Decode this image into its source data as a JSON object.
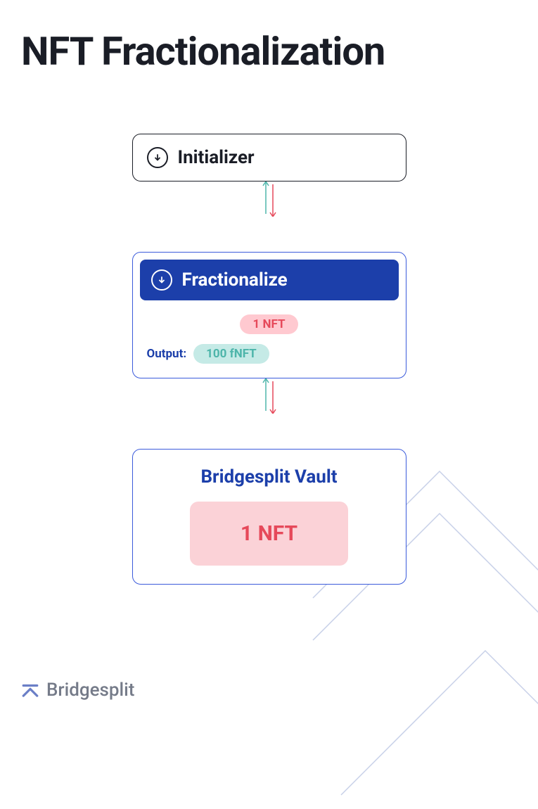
{
  "title": "NFT Fractionalization",
  "initializer": {
    "label": "Initializer"
  },
  "fractionalize": {
    "label": "Fractionalize",
    "input_pill": "1 NFT",
    "output_label": "Output:",
    "output_pill": "100 fNFT"
  },
  "vault": {
    "title": "Bridgesplit Vault",
    "content": "1 NFT"
  },
  "branding": {
    "name": "Bridgesplit"
  },
  "colors": {
    "dark": "#1a1d26",
    "blue": "#1c3faa",
    "blue_border": "#3b5bdb",
    "pink_bg": "#fbd2d7",
    "pink_text": "#e6495a",
    "teal_bg": "#c5eae6",
    "teal_text": "#4db5aa",
    "gray": "#757b89"
  }
}
